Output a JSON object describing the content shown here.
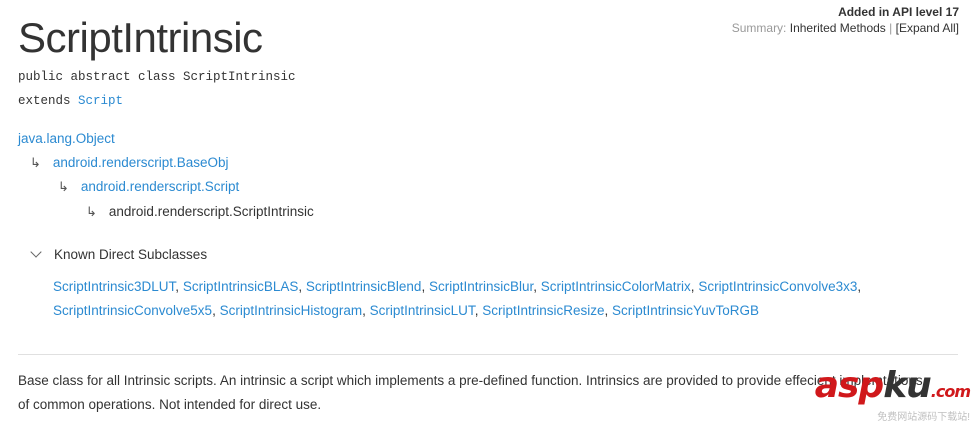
{
  "header": {
    "title": "ScriptIntrinsic",
    "api_level": "Added in API level 17",
    "summary_label": "Summary:",
    "inherited_methods_link": "Inherited Methods",
    "separator": "|",
    "expand_all_link": "[Expand All]"
  },
  "signature": {
    "declaration": "public abstract class ScriptIntrinsic",
    "extends_keyword": "extends",
    "extends_class": "Script"
  },
  "hierarchy": {
    "level0": "java.lang.Object",
    "level1": "android.renderscript.BaseObj",
    "level2": "android.renderscript.Script",
    "level3": "android.renderscript.ScriptIntrinsic",
    "arrow_glyph": "↳"
  },
  "subclasses": {
    "heading": "Known Direct Subclasses",
    "row1": [
      "ScriptIntrinsic3DLUT",
      "ScriptIntrinsicBLAS",
      "ScriptIntrinsicBlend",
      "ScriptIntrinsicBlur",
      "ScriptIntrinsicColorMatrix",
      "ScriptIntrinsicConvolve3x3"
    ],
    "row2": [
      "ScriptIntrinsicConvolve5x5",
      "ScriptIntrinsicHistogram",
      "ScriptIntrinsicLUT",
      "ScriptIntrinsicResize",
      "ScriptIntrinsicYuvToRGB"
    ],
    "separator": ", ",
    "row1_trailing": ","
  },
  "description": {
    "line1": "Base class for all Intrinsic scripts. An intrinsic a script which implements a pre-defined function. Intrinsics are provided to provide effecient implemtations",
    "line2": "of common operations. Not intended for direct use."
  },
  "watermark": {
    "logo_asp": "asp",
    "logo_ku": "ku",
    "logo_tld": ".com",
    "subtitle": "免费网站源码下载站!"
  },
  "colors": {
    "link": "#2b8ad1",
    "text": "#333333",
    "muted": "#999999",
    "divider": "#e0e0e0",
    "watermark_red": "#d0181b"
  }
}
